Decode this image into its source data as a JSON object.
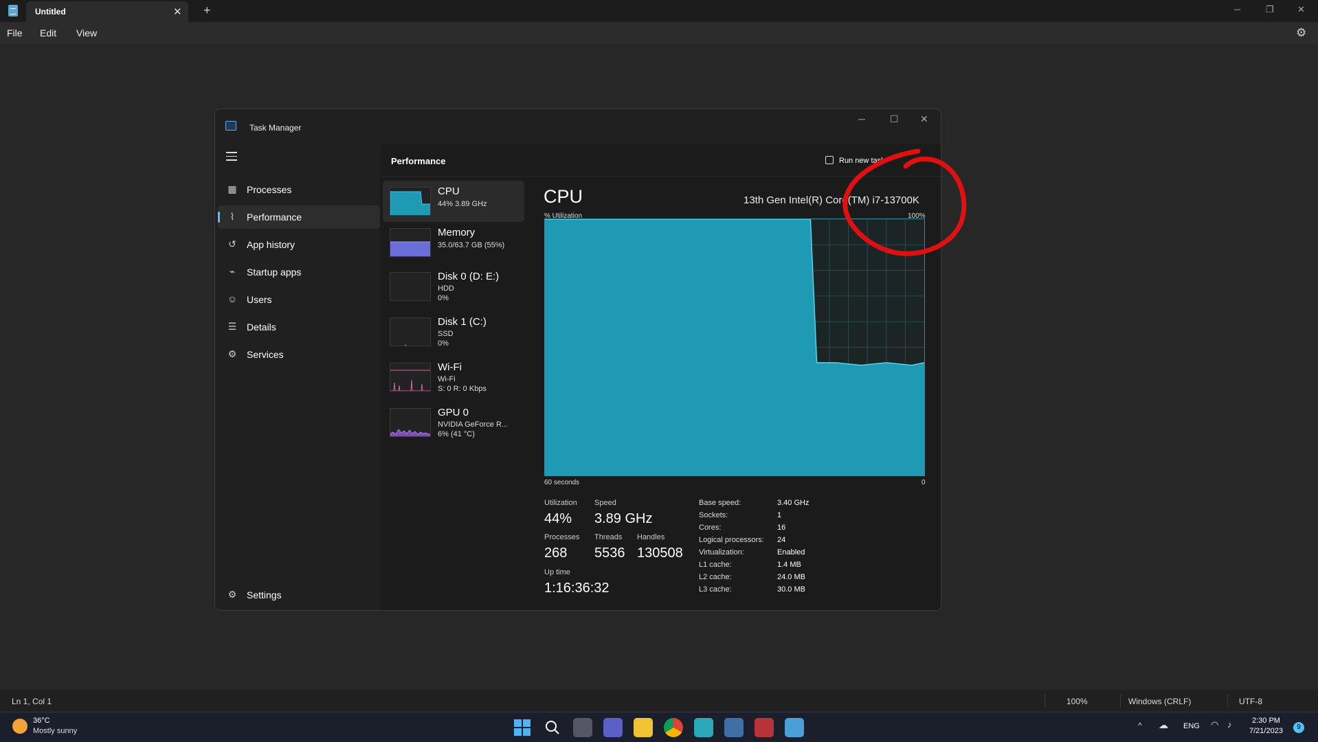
{
  "notepad": {
    "tab_title": "Untitled",
    "menu": [
      "File",
      "Edit",
      "View"
    ],
    "status": {
      "position": "Ln 1, Col 1",
      "zoom": "100%",
      "line_ending": "Windows (CRLF)",
      "encoding": "UTF-8"
    }
  },
  "task_manager": {
    "title": "Task Manager",
    "nav": [
      {
        "label": "Processes",
        "icon": "processes-icon"
      },
      {
        "label": "Performance",
        "icon": "performance-icon"
      },
      {
        "label": "App history",
        "icon": "history-icon"
      },
      {
        "label": "Startup apps",
        "icon": "startup-icon"
      },
      {
        "label": "Users",
        "icon": "users-icon"
      },
      {
        "label": "Details",
        "icon": "details-icon"
      },
      {
        "label": "Services",
        "icon": "services-icon"
      }
    ],
    "settings_label": "Settings",
    "page_title": "Performance",
    "run_task": "Run new task",
    "devices": [
      {
        "name": "CPU",
        "l1": "44% 3.89 GHz",
        "l2": ""
      },
      {
        "name": "Memory",
        "l1": "35.0/63.7 GB (55%)",
        "l2": ""
      },
      {
        "name": "Disk 0 (D: E:)",
        "l1": "HDD",
        "l2": "0%"
      },
      {
        "name": "Disk 1 (C:)",
        "l1": "SSD",
        "l2": "0%"
      },
      {
        "name": "Wi-Fi",
        "l1": "Wi-Fi",
        "l2": "S: 0 R: 0 Kbps"
      },
      {
        "name": "GPU 0",
        "l1": "NVIDIA GeForce R...",
        "l2": "6% (41 °C)"
      }
    ],
    "cpu": {
      "heading": "CPU",
      "model": "13th Gen Intel(R) Core(TM) i7-13700K",
      "y_label": "% Utilization",
      "y_max": "100%",
      "x_left": "60 seconds",
      "x_right": "0",
      "stats": {
        "utilization_label": "Utilization",
        "utilization": "44%",
        "speed_label": "Speed",
        "speed": "3.89 GHz",
        "processes_label": "Processes",
        "processes": "268",
        "threads_label": "Threads",
        "threads": "5536",
        "handles_label": "Handles",
        "handles": "130508",
        "uptime_label": "Up time",
        "uptime": "1:16:36:32"
      },
      "specs": [
        [
          "Base speed:",
          "3.40 GHz"
        ],
        [
          "Sockets:",
          "1"
        ],
        [
          "Cores:",
          "16"
        ],
        [
          "Logical processors:",
          "24"
        ],
        [
          "Virtualization:",
          "Enabled"
        ],
        [
          "L1 cache:",
          "1.4 MB"
        ],
        [
          "L2 cache:",
          "24.0 MB"
        ],
        [
          "L3 cache:",
          "30.0 MB"
        ]
      ]
    }
  },
  "chart_data": {
    "type": "area",
    "title": "",
    "xlabel": "",
    "ylabel": "% Utilization",
    "ylim": [
      0,
      100
    ],
    "x": [
      60,
      52,
      44,
      36,
      28,
      20,
      18,
      17,
      14,
      10,
      6,
      2,
      0
    ],
    "values": [
      100,
      100,
      100,
      100,
      100,
      100,
      100,
      44,
      44,
      43,
      44,
      43,
      44
    ]
  },
  "taskbar": {
    "weather_temp": "36°C",
    "weather_desc": "Mostly sunny",
    "lang": "ENG",
    "time": "2:30 PM",
    "date": "7/21/2023",
    "notif_count": "9"
  },
  "colors": {
    "accent": "#4cc2ff",
    "cpu_fill": "#1f9ab4",
    "cpu_line": "#2e8fa3",
    "memory": "#6b6ed8",
    "annotation": "#e01010"
  }
}
